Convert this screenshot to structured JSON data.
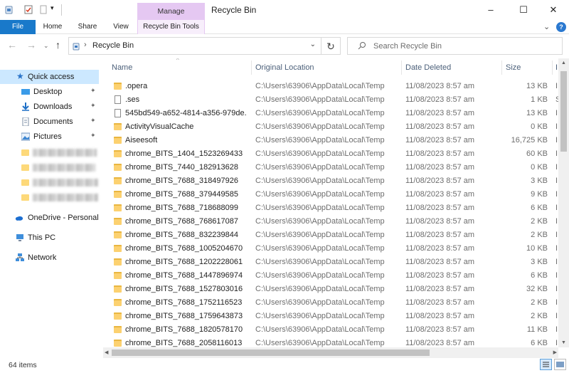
{
  "window": {
    "title": "Recycle Bin",
    "manage_tab": "Manage",
    "minimize": "–",
    "maximize": "☐",
    "close": "✕"
  },
  "ribbon": {
    "file": "File",
    "tabs": [
      "Home",
      "Share",
      "View"
    ],
    "tools_tab": "Recycle Bin Tools",
    "collapse_chevron": "⌄",
    "help": "?"
  },
  "address": {
    "back": "←",
    "forward": "→",
    "up": "↑",
    "separator": "›",
    "path": "Recycle Bin",
    "dropdown": "⌄",
    "refresh": "↻"
  },
  "search": {
    "placeholder": "Search Recycle Bin"
  },
  "sidebar": {
    "quick_access": "Quick access",
    "pinned": [
      {
        "label": "Desktop",
        "icon": "desktop-icon",
        "pin": "📌"
      },
      {
        "label": "Downloads",
        "icon": "downloads-icon",
        "pin": "📌"
      },
      {
        "label": "Documents",
        "icon": "documents-icon",
        "pin": "📌"
      },
      {
        "label": "Pictures",
        "icon": "pictures-icon",
        "pin": "📌"
      }
    ],
    "onedrive": "OneDrive - Personal",
    "this_pc": "This PC",
    "network": "Network"
  },
  "columns": {
    "name": "Name",
    "location": "Original Location",
    "date": "Date Deleted",
    "size": "Size",
    "extra": "I"
  },
  "files": [
    {
      "name": ".opera",
      "type": "folder",
      "location": "C:\\Users\\63906\\AppData\\Local\\Temp",
      "date": "11/08/2023 8:57 am",
      "size": "13 KB",
      "extra": "I"
    },
    {
      "name": ".ses",
      "type": "file",
      "location": "C:\\Users\\63906\\AppData\\Local\\Temp",
      "date": "11/08/2023 8:57 am",
      "size": "1 KB",
      "extra": "S"
    },
    {
      "name": "545bd549-a652-4814-a356-979de...",
      "type": "file",
      "location": "C:\\Users\\63906\\AppData\\Local\\Temp",
      "date": "11/08/2023 8:57 am",
      "size": "13 KB",
      "extra": "I"
    },
    {
      "name": "ActivityVisualCache",
      "type": "folder",
      "location": "C:\\Users\\63906\\AppData\\Local\\Temp",
      "date": "11/08/2023 8:57 am",
      "size": "0 KB",
      "extra": "I"
    },
    {
      "name": "Aiseesoft",
      "type": "folder",
      "location": "C:\\Users\\63906\\AppData\\Local\\Temp",
      "date": "11/08/2023 8:57 am",
      "size": "16,725 KB",
      "extra": "I"
    },
    {
      "name": "chrome_BITS_1404_1523269433",
      "type": "folder",
      "location": "C:\\Users\\63906\\AppData\\Local\\Temp",
      "date": "11/08/2023 8:57 am",
      "size": "60 KB",
      "extra": "I"
    },
    {
      "name": "chrome_BITS_7440_182913628",
      "type": "folder",
      "location": "C:\\Users\\63906\\AppData\\Local\\Temp",
      "date": "11/08/2023 8:57 am",
      "size": "0 KB",
      "extra": "I"
    },
    {
      "name": "chrome_BITS_7688_318497926",
      "type": "folder",
      "location": "C:\\Users\\63906\\AppData\\Local\\Temp",
      "date": "11/08/2023 8:57 am",
      "size": "3 KB",
      "extra": "I"
    },
    {
      "name": "chrome_BITS_7688_379449585",
      "type": "folder",
      "location": "C:\\Users\\63906\\AppData\\Local\\Temp",
      "date": "11/08/2023 8:57 am",
      "size": "9 KB",
      "extra": "I"
    },
    {
      "name": "chrome_BITS_7688_718688099",
      "type": "folder",
      "location": "C:\\Users\\63906\\AppData\\Local\\Temp",
      "date": "11/08/2023 8:57 am",
      "size": "6 KB",
      "extra": "I"
    },
    {
      "name": "chrome_BITS_7688_768617087",
      "type": "folder",
      "location": "C:\\Users\\63906\\AppData\\Local\\Temp",
      "date": "11/08/2023 8:57 am",
      "size": "2 KB",
      "extra": "I"
    },
    {
      "name": "chrome_BITS_7688_832239844",
      "type": "folder",
      "location": "C:\\Users\\63906\\AppData\\Local\\Temp",
      "date": "11/08/2023 8:57 am",
      "size": "2 KB",
      "extra": "I"
    },
    {
      "name": "chrome_BITS_7688_1005204670",
      "type": "folder",
      "location": "C:\\Users\\63906\\AppData\\Local\\Temp",
      "date": "11/08/2023 8:57 am",
      "size": "10 KB",
      "extra": "I"
    },
    {
      "name": "chrome_BITS_7688_1202228061",
      "type": "folder",
      "location": "C:\\Users\\63906\\AppData\\Local\\Temp",
      "date": "11/08/2023 8:57 am",
      "size": "3 KB",
      "extra": "I"
    },
    {
      "name": "chrome_BITS_7688_1447896974",
      "type": "folder",
      "location": "C:\\Users\\63906\\AppData\\Local\\Temp",
      "date": "11/08/2023 8:57 am",
      "size": "6 KB",
      "extra": "I"
    },
    {
      "name": "chrome_BITS_7688_1527803016",
      "type": "folder",
      "location": "C:\\Users\\63906\\AppData\\Local\\Temp",
      "date": "11/08/2023 8:57 am",
      "size": "32 KB",
      "extra": "I"
    },
    {
      "name": "chrome_BITS_7688_1752116523",
      "type": "folder",
      "location": "C:\\Users\\63906\\AppData\\Local\\Temp",
      "date": "11/08/2023 8:57 am",
      "size": "2 KB",
      "extra": "I"
    },
    {
      "name": "chrome_BITS_7688_1759643873",
      "type": "folder",
      "location": "C:\\Users\\63906\\AppData\\Local\\Temp",
      "date": "11/08/2023 8:57 am",
      "size": "2 KB",
      "extra": "I"
    },
    {
      "name": "chrome_BITS_7688_1820578170",
      "type": "folder",
      "location": "C:\\Users\\63906\\AppData\\Local\\Temp",
      "date": "11/08/2023 8:57 am",
      "size": "11 KB",
      "extra": "I"
    },
    {
      "name": "chrome_BITS_7688_2058116013",
      "type": "folder",
      "location": "C:\\Users\\63906\\AppData\\Local\\Temp",
      "date": "11/08/2023 8:57 am",
      "size": "6 KB",
      "extra": "I"
    }
  ],
  "status": {
    "item_count": "64 items"
  },
  "colors": {
    "accent": "#1979ca",
    "manage": "#e5c8f2",
    "selected": "#cce8ff",
    "folder": "#fcd170"
  }
}
